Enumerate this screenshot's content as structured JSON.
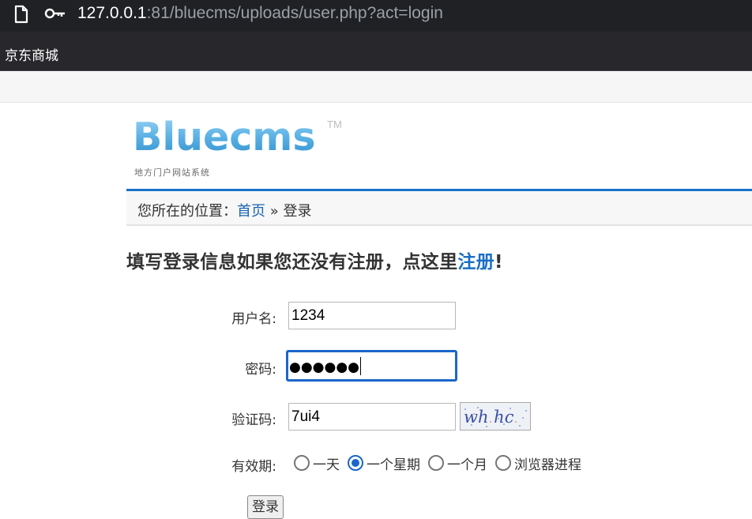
{
  "browser": {
    "url_host": "127.0.0.1",
    "url_rest": ":81/bluecms/uploads/user.php?act=login",
    "bookmarks": [
      "京东商城"
    ]
  },
  "logo": {
    "wordmark": "Bluecms",
    "tm": "TM",
    "tagline": "地方门户网站系统"
  },
  "breadcrumb": {
    "prefix": "您所在的位置：",
    "home_link": "首页",
    "separator": "»",
    "current": "登录"
  },
  "heading": {
    "text": "填写登录信息如果您还没有注册，点这里",
    "register_link": "注册",
    "suffix": "!"
  },
  "form": {
    "username_label": "用户名:",
    "username_value": "1234",
    "password_label": "密码:",
    "password_mask": "●●●●●●",
    "captcha_label": "验证码:",
    "captcha_value": "7ui4",
    "captcha_image_text": "wh hc",
    "remember_label": "有效期:",
    "remember_options": [
      "一天",
      "一个星期",
      "一个月",
      "浏览器进程"
    ],
    "remember_selected": "一个星期",
    "submit_label": "登录"
  },
  "colors": {
    "accent": "#1a73c8",
    "link": "#1a64b0",
    "focus": "#1a66c9"
  }
}
